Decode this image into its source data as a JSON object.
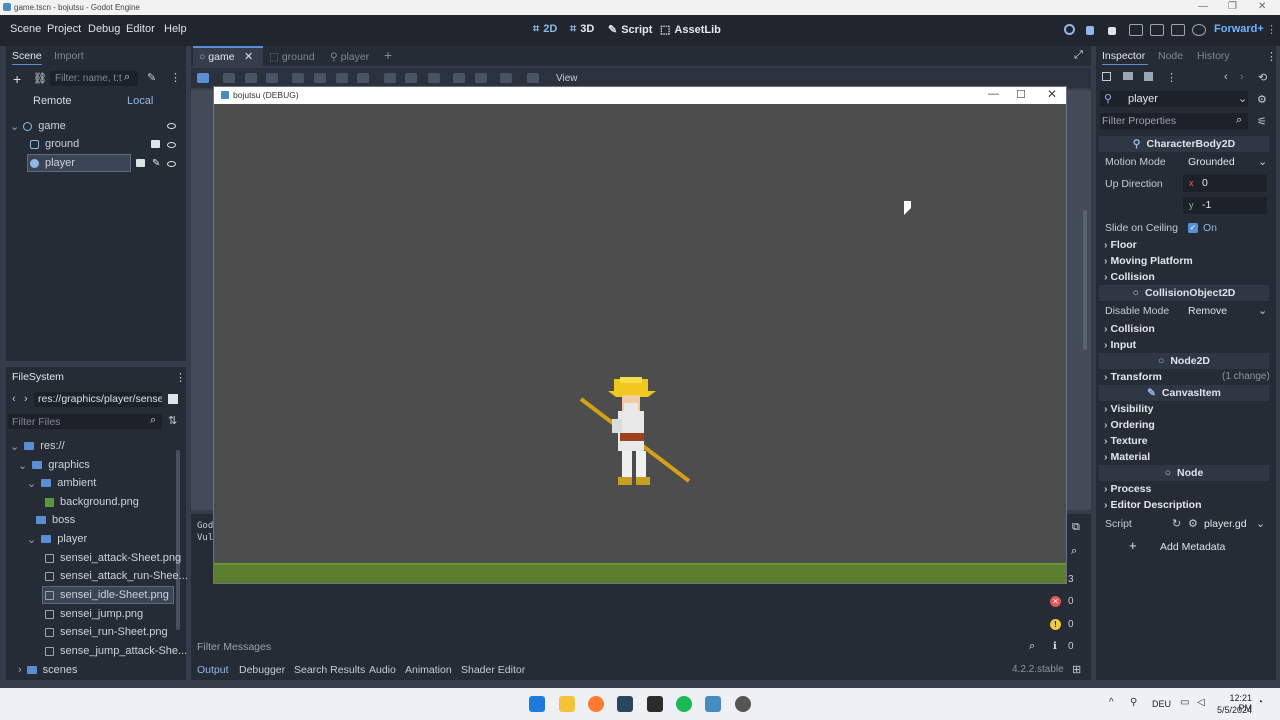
{
  "window": {
    "title": "game.tscn - bojutsu - Godot Engine"
  },
  "menu": {
    "items": [
      "Scene",
      "Project",
      "Debug",
      "Editor",
      "Help"
    ]
  },
  "modes": {
    "d2": "2D",
    "d3": "3D",
    "script": "Script",
    "assetlib": "AssetLib"
  },
  "renderer": "Forward+",
  "scene_panel": {
    "tab_scene": "Scene",
    "tab_import": "Import",
    "filter_placeholder": "Filter: name, t:t",
    "remote": "Remote",
    "local": "Local",
    "nodes": {
      "root": "game",
      "ground": "ground",
      "player": "player"
    }
  },
  "filesystem": {
    "title": "FileSystem",
    "path": "res://graphics/player/sense",
    "filter_placeholder": "Filter Files",
    "items": {
      "res": "res://",
      "graphics": "graphics",
      "ambient": "ambient",
      "background": "background.png",
      "boss": "boss",
      "player": "player",
      "f1": "sensei_attack-Sheet.png",
      "f2": "sensei_attack_run-Shee...",
      "f3": "sensei_idle-Sheet.png",
      "f4": "sensei_jump.png",
      "f5": "sensei_run-Sheet.png",
      "f6": "sense_jump_attack-She...",
      "scenes": "scenes"
    }
  },
  "editor_tabs": {
    "game": "game",
    "ground": "ground",
    "player": "player"
  },
  "toolbar": {
    "view": "View"
  },
  "game_window": {
    "title": "bojutsu (DEBUG)"
  },
  "output": {
    "line1": "Godo",
    "line2": "Vul",
    "filter": "Filter Messages",
    "count_total": "3",
    "count_errors": "0",
    "count_warnings": "0",
    "count_info": "0"
  },
  "bottom_tabs": {
    "output": "Output",
    "debugger": "Debugger",
    "search": "Search Results",
    "audio": "Audio",
    "animation": "Animation",
    "shader": "Shader Editor"
  },
  "version": "4.2.2.stable",
  "inspector": {
    "tab_inspector": "Inspector",
    "tab_node": "Node",
    "tab_history": "History",
    "object": "player",
    "filter_placeholder": "Filter Properties",
    "class1": "CharacterBody2D",
    "motion_mode_label": "Motion Mode",
    "motion_mode_value": "Grounded",
    "up_dir_label": "Up Direction",
    "up_x_label": "x",
    "up_x": "0",
    "up_y_label": "y",
    "up_y": "-1",
    "slide_label": "Slide on Ceiling",
    "slide_value": "On",
    "floor": "Floor",
    "moving_platform": "Moving Platform",
    "collision1": "Collision",
    "class2": "CollisionObject2D",
    "disable_mode_label": "Disable Mode",
    "disable_mode_value": "Remove",
    "collision2": "Collision",
    "input": "Input",
    "class3": "Node2D",
    "transform": "Transform",
    "transform_changes": "(1 change)",
    "class4": "CanvasItem",
    "visibility": "Visibility",
    "ordering": "Ordering",
    "texture": "Texture",
    "material": "Material",
    "class5": "Node",
    "process": "Process",
    "editor_description": "Editor Description",
    "script_label": "Script",
    "script_value": "player.gd",
    "add_metadata": "Add Metadata"
  },
  "taskbar": {
    "lang": "DEU",
    "time": "12:21 PM",
    "date": "5/5/2024"
  },
  "colors": {
    "accent": "#478cbf",
    "ground": "#5b7f2e",
    "viewport_bg": "#4d4d4d"
  }
}
